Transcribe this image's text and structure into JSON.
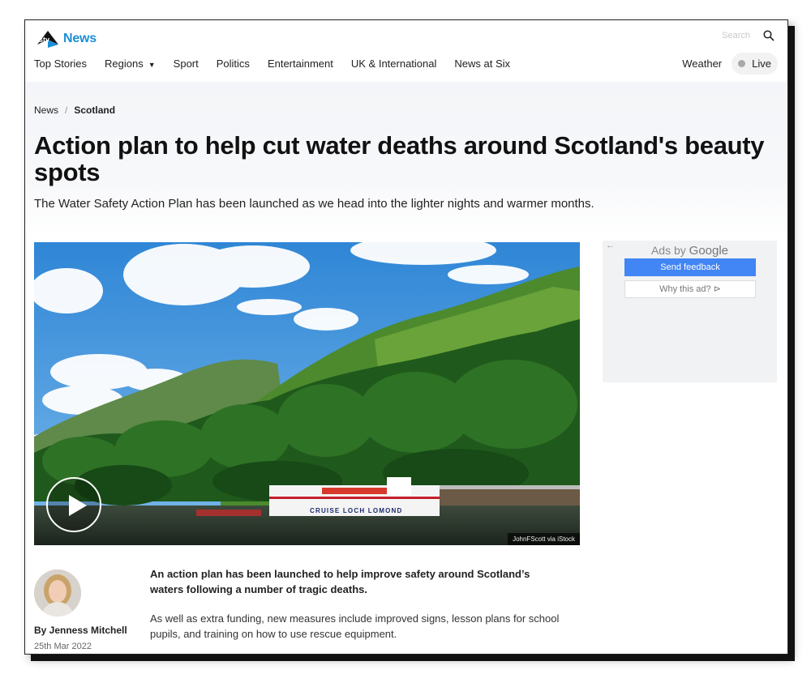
{
  "header": {
    "brand": "News",
    "search_placeholder": "Search",
    "nav": [
      "Top Stories",
      "Regions",
      "Sport",
      "Politics",
      "Entertainment",
      "UK & International",
      "News at Six"
    ],
    "weather": "Weather",
    "live": "Live"
  },
  "breadcrumb": {
    "home": "News",
    "separator": "/",
    "section": "Scotland"
  },
  "article": {
    "headline": "Action plan to help cut water deaths around Scotland's beauty spots",
    "standfirst": "The Water Safety Action Plan has been launched as we head into the lighter nights and warmer months.",
    "image_credit": "JohnFScott via iStock",
    "boat_name": "CRUISE LOCH LOMOND",
    "author": "By Jenness Mitchell",
    "date": "25th Mar 2022",
    "lead": "An action plan has been launched to help improve safety around Scotland’s waters following a number of tragic deaths.",
    "paragraph": "As well as extra funding, new measures include improved signs, lesson plans for school pupils, and training on how to use rescue equipment."
  },
  "ad": {
    "back_glyph": "←",
    "ads_by": "Ads by",
    "google": "Google",
    "send_feedback": "Send feedback",
    "why_this_ad": "Why this ad? ⊳"
  },
  "colors": {
    "brand_blue": "#1c8fd6",
    "feedback_blue": "#4285f4"
  }
}
